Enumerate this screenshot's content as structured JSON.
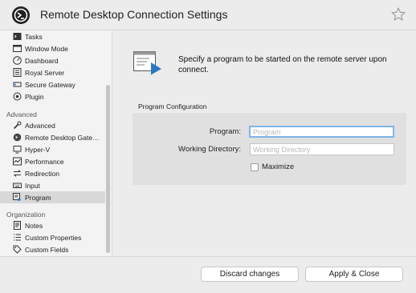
{
  "window": {
    "title": "Remote Desktop Connection Settings"
  },
  "sidebar": {
    "items_top": [
      {
        "label": "Tasks",
        "icon": "terminal-icon"
      },
      {
        "label": "Window Mode",
        "icon": "window-icon"
      },
      {
        "label": "Dashboard",
        "icon": "dashboard-icon"
      },
      {
        "label": "Royal Server",
        "icon": "server-icon"
      },
      {
        "label": "Secure Gateway",
        "icon": "gateway-icon"
      },
      {
        "label": "Plugin",
        "icon": "plugin-icon"
      }
    ],
    "section_advanced": "Advanced",
    "items_advanced": [
      {
        "label": "Advanced",
        "icon": "tools-icon"
      },
      {
        "label": "Remote Desktop Gate…",
        "icon": "rd-gateway-icon"
      },
      {
        "label": "Hyper-V",
        "icon": "hyperv-icon"
      },
      {
        "label": "Performance",
        "icon": "performance-icon"
      },
      {
        "label": "Redirection",
        "icon": "redirection-icon"
      },
      {
        "label": "Input",
        "icon": "input-icon"
      },
      {
        "label": "Program",
        "icon": "program-icon",
        "selected": true
      }
    ],
    "section_organization": "Organization",
    "items_organization": [
      {
        "label": "Notes",
        "icon": "notes-icon"
      },
      {
        "label": "Custom Properties",
        "icon": "list-icon"
      },
      {
        "label": "Custom Fields",
        "icon": "tag-icon"
      }
    ]
  },
  "main": {
    "description": "Specify a program to be started on the remote server upon connect.",
    "group_title": "Program Configuration",
    "program_label": "Program:",
    "program_value": "",
    "program_placeholder": "Program",
    "workdir_label": "Working Directory:",
    "workdir_value": "",
    "workdir_placeholder": "Working Directory",
    "maximize_label": "Maximize",
    "maximize_checked": false
  },
  "footer": {
    "discard_label": "Discard changes",
    "apply_label": "Apply & Close"
  },
  "colors": {
    "focus_ring": "#7fb4ea",
    "selection": "#d8d8d8",
    "accent_icon": "#2a78c8"
  }
}
